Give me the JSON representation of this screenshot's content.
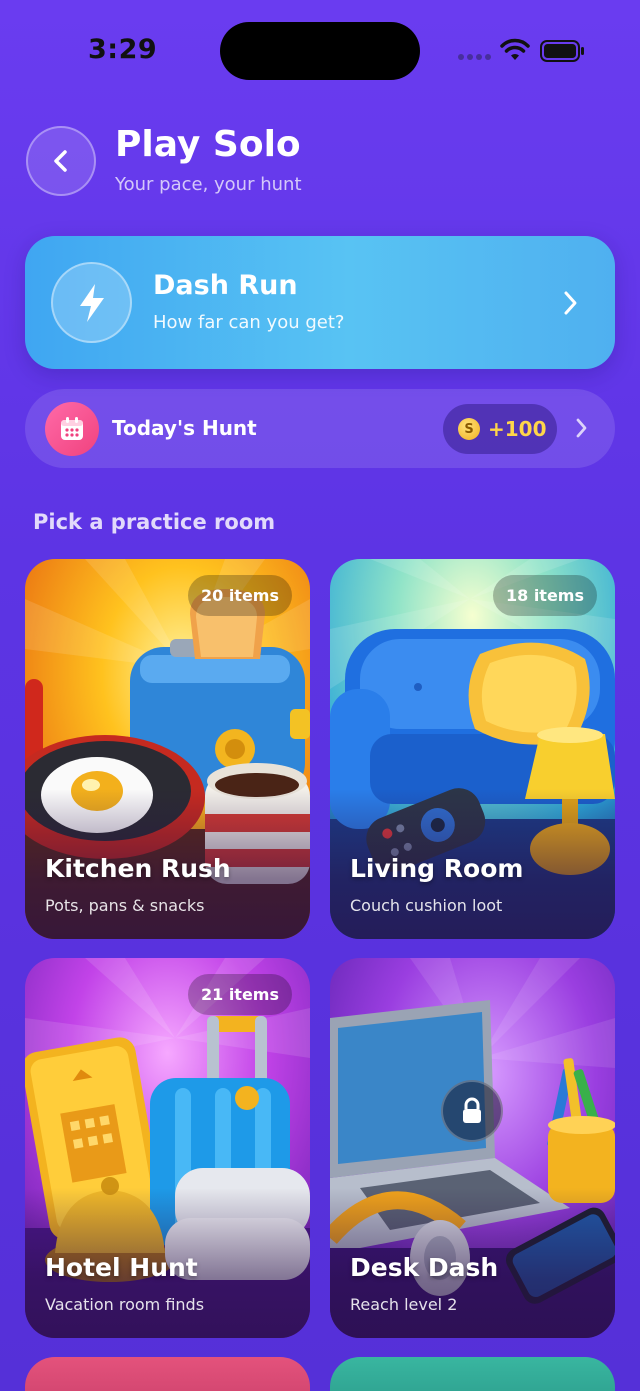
{
  "status_bar": {
    "time": "3:29"
  },
  "header": {
    "title": "Play Solo",
    "subtitle": "Your pace, your hunt"
  },
  "dash_run": {
    "title": "Dash Run",
    "subtitle": "How far can you get?"
  },
  "todays_hunt": {
    "label": "Today's Hunt",
    "coin_symbol": "S",
    "reward": "+100"
  },
  "section": {
    "title": "Pick a practice room"
  },
  "rooms": [
    {
      "title": "Kitchen Rush",
      "subtitle": "Pots, pans & snacks",
      "items": "20 items",
      "locked": false
    },
    {
      "title": "Living Room",
      "subtitle": "Couch cushion loot",
      "items": "18 items",
      "locked": false
    },
    {
      "title": "Hotel Hunt",
      "subtitle": "Vacation room finds",
      "items": "21 items",
      "locked": false
    },
    {
      "title": "Desk Dash",
      "subtitle": "Reach level 2",
      "items": "",
      "locked": true
    }
  ],
  "colors": {
    "background": "#5d34e4",
    "dash_card": "#4fb6f2",
    "reward": "#ffd54a",
    "hunt_icon": "#f0427e"
  },
  "icons": [
    "back-chevron-icon",
    "lightning-icon",
    "calendar-icon",
    "coin-icon",
    "chevron-right-icon",
    "lock-icon"
  ]
}
